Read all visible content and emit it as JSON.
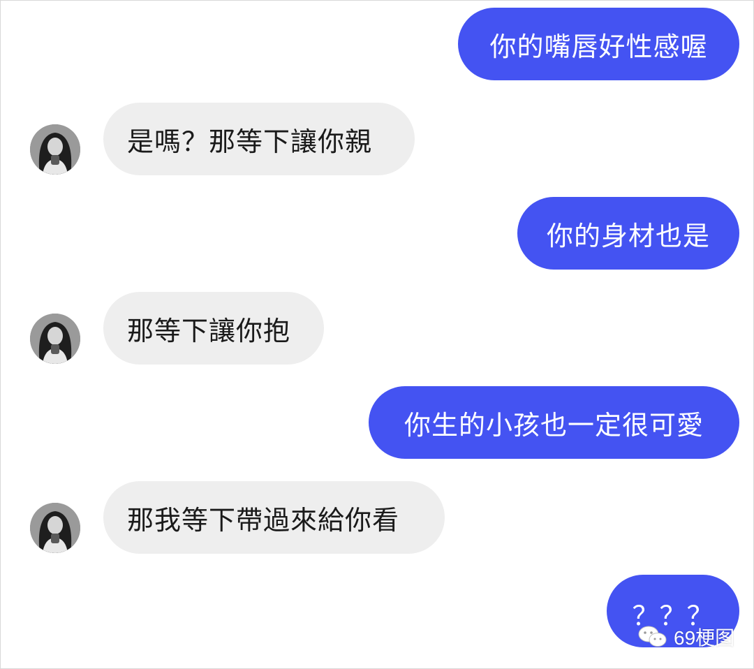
{
  "colors": {
    "sent_bubble": "#4453f2",
    "received_bubble": "#eeeeee",
    "received_text": "#1a1a1a",
    "sent_text": "#ffffff"
  },
  "messages": [
    {
      "direction": "sent",
      "text": "你的嘴唇好性感喔"
    },
    {
      "direction": "received",
      "text": "是嗎？那等下讓你親"
    },
    {
      "direction": "sent",
      "text": "你的身材也是"
    },
    {
      "direction": "received",
      "text": "那等下讓你抱"
    },
    {
      "direction": "sent",
      "text": "你生的小孩也一定很可愛"
    },
    {
      "direction": "received",
      "text": "那我等下帶過來給你看"
    },
    {
      "direction": "sent",
      "text": "？？？"
    }
  ],
  "watermark": {
    "icon": "wechat-icon",
    "text": "69梗图"
  }
}
